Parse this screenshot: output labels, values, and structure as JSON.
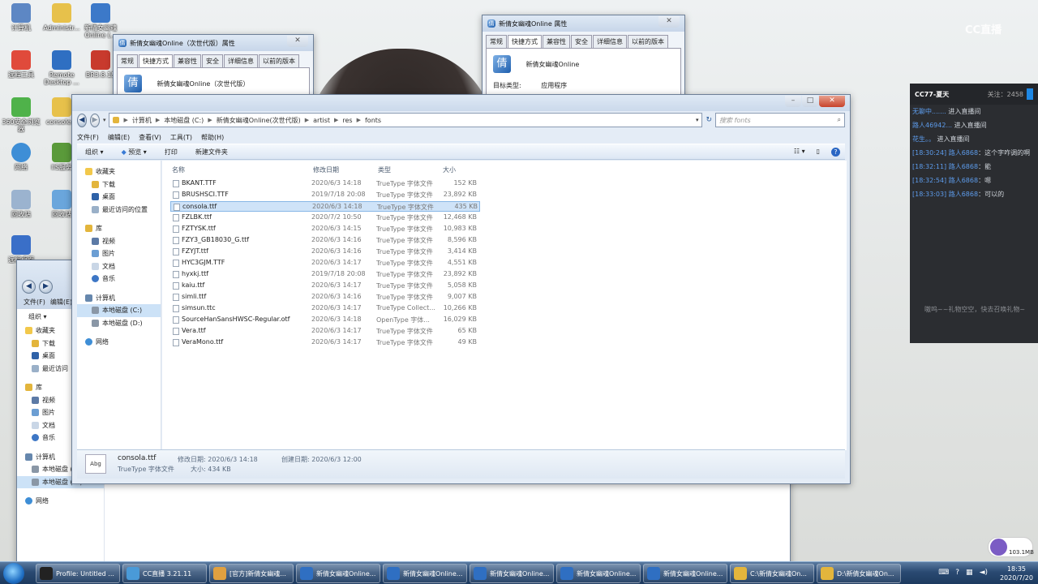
{
  "desktop": {
    "icons": [
      "计算机",
      "Administr...",
      "新倩女幽魂 Online (...",
      "远程工具",
      "Remote Desktop ...",
      "BR3.8.15",
      "360安全浏览器",
      "console...",
      "网络",
      "IIS服务",
      "回收站",
      "回收站",
      "远程桌面"
    ],
    "watermark": "CC直播"
  },
  "props_win_1": {
    "title": "新倩女幽魂Online（次世代版）属性",
    "tabs": [
      "常规",
      "快捷方式",
      "兼容性",
      "安全",
      "详细信息",
      "以前的版本"
    ],
    "app_name": "新倩女幽魂Online（次世代版）"
  },
  "props_win_2": {
    "title": "新倩女幽魂Online 属性",
    "tabs": [
      "常规",
      "快捷方式",
      "兼容性",
      "安全",
      "详细信息",
      "以前的版本"
    ],
    "app_name": "新倩女幽魂Online",
    "target_type_label": "目标类型:",
    "target_type_value": "应用程序"
  },
  "explorer": {
    "breadcrumbs": [
      "计算机",
      "本地磁盘 (C:)",
      "新倩女幽魂Online(次世代版)",
      "artist",
      "res",
      "fonts"
    ],
    "search_placeholder": "搜索 fonts",
    "menu": [
      "文件(F)",
      "编辑(E)",
      "查看(V)",
      "工具(T)",
      "帮助(H)"
    ],
    "toolbar": [
      "组织 ▾",
      "预览 ▾",
      "打印",
      "新建文件夹"
    ],
    "nav": {
      "favorites": "收藏夹",
      "fav_items": [
        "下载",
        "桌面",
        "最近访问的位置"
      ],
      "libraries": "库",
      "lib_items": [
        "视频",
        "图片",
        "文档",
        "音乐"
      ],
      "computer": "计算机",
      "computer_items": [
        "本地磁盘 (C:)",
        "本地磁盘 (D:)"
      ],
      "network": "网络"
    },
    "columns": [
      "名称",
      "修改日期",
      "类型",
      "大小"
    ],
    "files": [
      {
        "name": "BKANT.TTF",
        "date": "2020/6/3 14:18",
        "type": "TrueType 字体文件",
        "size": "152 KB"
      },
      {
        "name": "BRUSHSCI.TTF",
        "date": "2019/7/18 20:08",
        "type": "TrueType 字体文件",
        "size": "23,892 KB"
      },
      {
        "name": "consola.ttf",
        "date": "2020/6/3 14:18",
        "type": "TrueType 字体文件",
        "size": "435 KB"
      },
      {
        "name": "FZLBK.ttf",
        "date": "2020/7/2 10:50",
        "type": "TrueType 字体文件",
        "size": "12,468 KB"
      },
      {
        "name": "FZTYSK.ttf",
        "date": "2020/6/3 14:15",
        "type": "TrueType 字体文件",
        "size": "10,983 KB"
      },
      {
        "name": "FZY3_GB18030_G.ttf",
        "date": "2020/6/3 14:16",
        "type": "TrueType 字体文件",
        "size": "8,596 KB"
      },
      {
        "name": "FZYJT.ttf",
        "date": "2020/6/3 14:16",
        "type": "TrueType 字体文件",
        "size": "3,414 KB"
      },
      {
        "name": "HYC3GJM.TTF",
        "date": "2020/6/3 14:17",
        "type": "TrueType 字体文件",
        "size": "4,551 KB"
      },
      {
        "name": "hyxkj.ttf",
        "date": "2019/7/18 20:08",
        "type": "TrueType 字体文件",
        "size": "23,892 KB"
      },
      {
        "name": "kaiu.ttf",
        "date": "2020/6/3 14:17",
        "type": "TrueType 字体文件",
        "size": "5,058 KB"
      },
      {
        "name": "simli.ttf",
        "date": "2020/6/3 14:16",
        "type": "TrueType 字体文件",
        "size": "9,007 KB"
      },
      {
        "name": "simsun.ttc",
        "date": "2020/6/3 14:17",
        "type": "TrueType Collect...",
        "size": "10,266 KB"
      },
      {
        "name": "SourceHanSansHWSC-Regular.otf",
        "date": "2020/6/3 14:18",
        "type": "OpenType 字体...",
        "size": "16,029 KB"
      },
      {
        "name": "Vera.ttf",
        "date": "2020/6/3 14:17",
        "type": "TrueType 字体文件",
        "size": "65 KB"
      },
      {
        "name": "VeraMono.ttf",
        "date": "2020/6/3 14:17",
        "type": "TrueType 字体文件",
        "size": "49 KB"
      }
    ],
    "selected_index": 2,
    "details": {
      "thumb": "Abg",
      "name": "consola.ttf",
      "type": "TrueType 字体文件",
      "modified": "修改日期: 2020/6/3 14:18",
      "size": "大小: 434 KB",
      "created": "创建日期: 2020/6/3 12:00"
    }
  },
  "explorer2": {
    "menu": [
      "文件(F)",
      "编辑(E)"
    ],
    "organize": "组织 ▾",
    "nav": [
      "收藏夹",
      "下载",
      "桌面",
      "最近访问",
      "库",
      "视频",
      "图片",
      "文档",
      "音乐",
      "计算机",
      "本地磁盘 (C:)",
      "本地磁盘 (D:)",
      "网络"
    ]
  },
  "chat": {
    "host": "CC77-夏天",
    "follow": "关注：2458",
    "lines": [
      {
        "who": "无聊中.......",
        "text": " 进入直播间"
      },
      {
        "who": "路人46942...",
        "text": " 进入直播间"
      },
      {
        "who": "花生。。",
        "text": " 进入直播间"
      },
      {
        "who": "[18:30:24] 路人6868",
        "text": "：这个字咋调的啊"
      },
      {
        "who": "[18:32:11] 路人6868",
        "text": "：能"
      },
      {
        "who": "[18:32:54] 路人6868",
        "text": "：嗯"
      },
      {
        "who": "[18:33:03] 路人6868",
        "text": "：可以的"
      }
    ],
    "footer": "嗷呜~~礼物空空，快去召唤礼物~"
  },
  "taskbar": {
    "tasks": [
      "Profile: Untitled ...",
      "CC直播 3.21.11",
      "[官方]新倩女幽魂...",
      "新倩女幽魂Online...",
      "新倩女幽魂Online...",
      "新倩女幽魂Online...",
      "新倩女幽魂Online...",
      "新倩女幽魂Online...",
      "C:\\新倩女幽魂On...",
      "D:\\新倩女幽魂On..."
    ],
    "time": "18:35",
    "date": "2020/7/20",
    "net_speed": "103.1MB"
  }
}
